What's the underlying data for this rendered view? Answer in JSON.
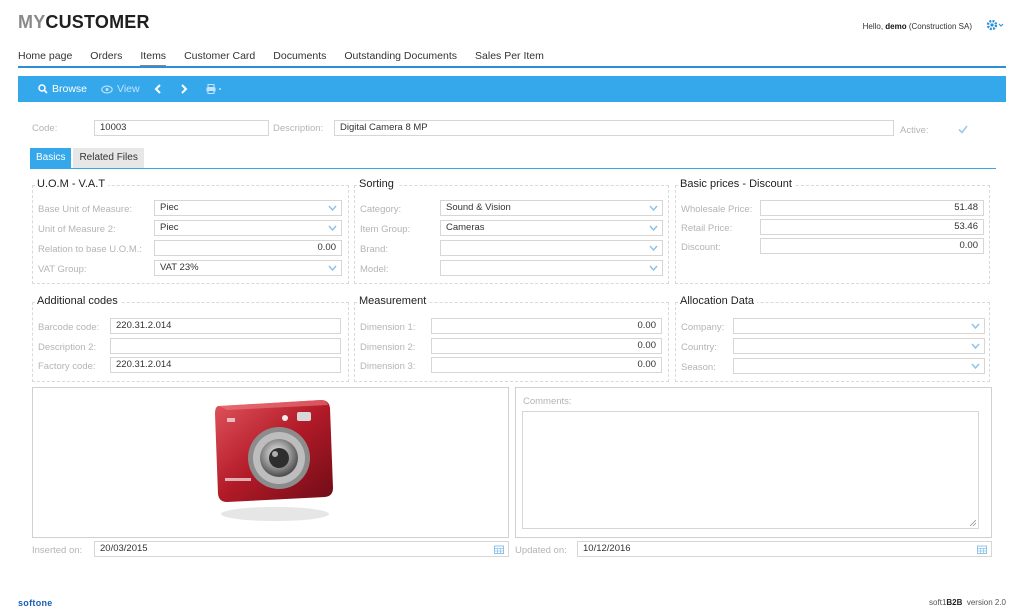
{
  "header": {
    "logo_my": "MY",
    "logo_customer": "CUSTOMER",
    "hello_prefix": "Hello, ",
    "user": "demo",
    "company": " (Construction SA)"
  },
  "nav": {
    "items": [
      "Home page",
      "Orders",
      "Items",
      "Customer Card",
      "Documents",
      "Outstanding Documents",
      "Sales Per Item"
    ],
    "active": "Items"
  },
  "toolbar": {
    "browse": "Browse",
    "view": "View"
  },
  "record": {
    "code_label": "Code:",
    "code": "10003",
    "description_label": "Description:",
    "description": "Digital Camera 8 MP",
    "active_label": "Active:"
  },
  "tabs": [
    "Basics",
    "Related Files"
  ],
  "uom": {
    "title": "U.O.M - V.A.T",
    "base_unit_label": "Base Unit of Measure:",
    "base_unit": "Piec",
    "unit2_label": "Unit of Measure 2:",
    "unit2": "Piec",
    "relation_label": "Relation to base U.O.M.:",
    "relation": "0.00",
    "vat_label": "VAT Group:",
    "vat": "VAT 23%"
  },
  "sorting": {
    "title": "Sorting",
    "category_label": "Category:",
    "category": "Sound & Vision",
    "item_group_label": "Item Group:",
    "item_group": "Cameras",
    "brand_label": "Brand:",
    "brand": "",
    "model_label": "Model:",
    "model": ""
  },
  "prices": {
    "title": "Basic prices - Discount",
    "wholesale_label": "Wholesale Price:",
    "wholesale": "51.48",
    "retail_label": "Retail Price:",
    "retail": "53.46",
    "discount_label": "Discount:",
    "discount": "0.00"
  },
  "codes": {
    "title": "Additional codes",
    "barcode_label": "Barcode code:",
    "barcode": "220.31.2.014",
    "desc2_label": "Description 2:",
    "desc2": "",
    "factory_label": "Factory code:",
    "factory": "220.31.2.014"
  },
  "measurement": {
    "title": "Measurement",
    "dim1_label": "Dimension 1:",
    "dim1": "0.00",
    "dim2_label": "Dimension 2:",
    "dim2": "0.00",
    "dim3_label": "Dimension 3:",
    "dim3": "0.00"
  },
  "allocation": {
    "title": "Allocation Data",
    "company_label": "Company:",
    "company": "",
    "country_label": "Country:",
    "country": "",
    "season_label": "Season:",
    "season": ""
  },
  "comments_label": "Comments:",
  "dates": {
    "inserted_label": "Inserted on:",
    "inserted": "20/03/2015",
    "updated_label": "Updated on:",
    "updated": "10/12/2016"
  },
  "footer": {
    "brand": "softone",
    "product_a": "soft1",
    "product_b": "B2B",
    "version": "version 2.0"
  },
  "colors": {
    "accent": "#35a8ec",
    "nav_line": "#2a8fd8",
    "footer_brand": "#1a5fb4"
  },
  "icons": [
    "search-icon",
    "eye-icon",
    "chevron-left-icon",
    "chevron-right-icon",
    "print-icon",
    "gear-icon",
    "chevron-down-icon",
    "check-icon",
    "calendar-icon",
    "camera-image"
  ]
}
